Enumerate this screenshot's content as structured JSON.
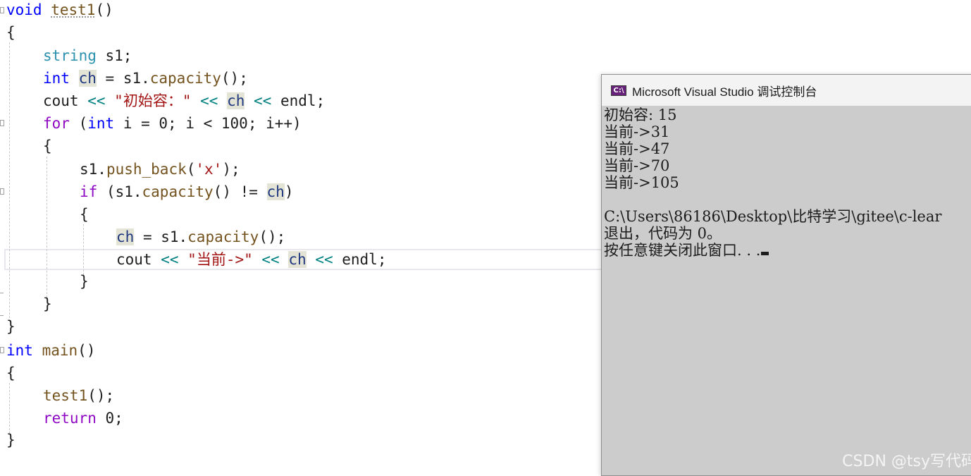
{
  "editor": {
    "l1": {
      "kw": "void",
      "fn": "test1",
      "p": "()"
    },
    "l2": {
      "t": "{"
    },
    "l3": {
      "typ": "string",
      "rest": " s1;"
    },
    "l4": {
      "kw": "int",
      "var": "ch",
      "a": " = s1.",
      "fn": "capacity",
      "b": "();"
    },
    "l5": {
      "a": "cout ",
      "op1": "<<",
      "sp1": " ",
      "str": "\"初始容：\"",
      "sp2": " ",
      "op2": "<<",
      "sp3": " ",
      "var": "ch",
      "sp4": " ",
      "op3": "<<",
      "b": " endl;"
    },
    "l6": {
      "ctl": "for",
      "a": " (",
      "kw": "int",
      "b": " i = 0; i < 100; i++)"
    },
    "l7": {
      "t": "{"
    },
    "l8": {
      "a": "s1.",
      "fn": "push_back",
      "b": "(",
      "str": "'x'",
      "c": ");"
    },
    "l9": {
      "ctl": "if",
      "a": " (s1.",
      "fn": "capacity",
      "b": "() != ",
      "var": "ch",
      "c": ")"
    },
    "l10": {
      "t": "{"
    },
    "l11": {
      "var": "ch",
      "a": " = s1.",
      "fn": "capacity",
      "b": "();"
    },
    "l12": {
      "a": "cout ",
      "op1": "<<",
      "sp1": " ",
      "str": "\"当前->\"",
      "sp2": " ",
      "op2": "<<",
      "sp3": " ",
      "var": "ch",
      "sp4": " ",
      "op3": "<<",
      "b": " endl;"
    },
    "l13": {
      "t": "}"
    },
    "l14": {
      "t": "}"
    },
    "l15": {
      "t": "}"
    },
    "l16": {
      "kw": "int",
      "sp": " ",
      "fn": "main",
      "p": "()"
    },
    "l17": {
      "t": "{"
    },
    "l18": {
      "fn": "test1",
      "b": "();"
    },
    "l19": {
      "ctl": "return",
      "b": " 0;"
    },
    "l20": {
      "t": "}"
    }
  },
  "console": {
    "icon_label": "C:\\",
    "title": "Microsoft Visual Studio 调试控制台",
    "lines": [
      "初始容: 15",
      "当前->31",
      "当前->47",
      "当前->70",
      "当前->105",
      "",
      "C:\\Users\\86186\\Desktop\\比特学习\\gitee\\c-lear",
      "退出，代码为 0。",
      "按任意键关闭此窗口. . ."
    ],
    "watermark": "CSDN @tsy写代码"
  },
  "colors": {
    "keyword": "#0000ff",
    "type": "#2b91af",
    "control": "#8f08c4",
    "variable": "#1f377f",
    "string": "#a31515",
    "operator": "#008080",
    "function": "#74531f",
    "console_bg": "#cccccc"
  },
  "icons": [
    "fold-marker-icon",
    "console-app-icon",
    "text-cursor-icon"
  ]
}
